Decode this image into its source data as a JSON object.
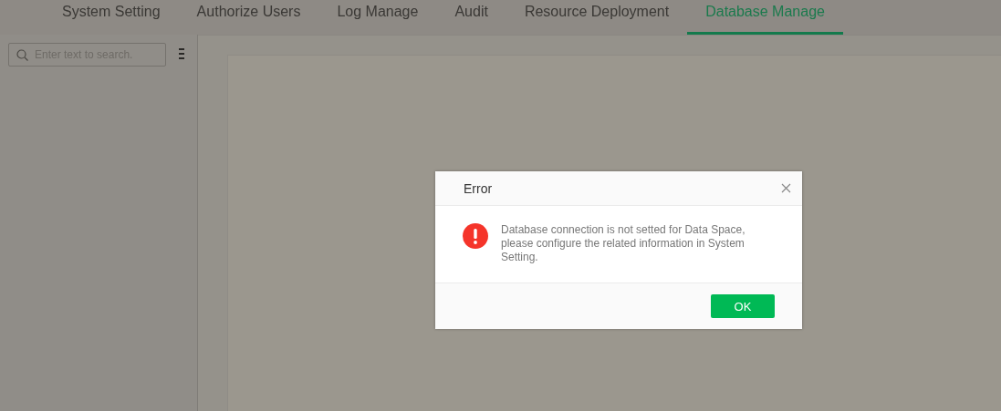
{
  "tabs": [
    {
      "label": "System Setting",
      "selected": false
    },
    {
      "label": "Authorize Users",
      "selected": false
    },
    {
      "label": "Log Manage",
      "selected": false
    },
    {
      "label": "Audit",
      "selected": false
    },
    {
      "label": "Resource Deployment",
      "selected": false
    },
    {
      "label": "Database Manage",
      "selected": true
    }
  ],
  "sidebar": {
    "search": {
      "placeholder": "Enter text to search."
    }
  },
  "dialog": {
    "title": "Error",
    "message": "Database connection is not setted for Data Space, please configure the related information in System Setting.",
    "buttons": [
      "OK"
    ]
  }
}
